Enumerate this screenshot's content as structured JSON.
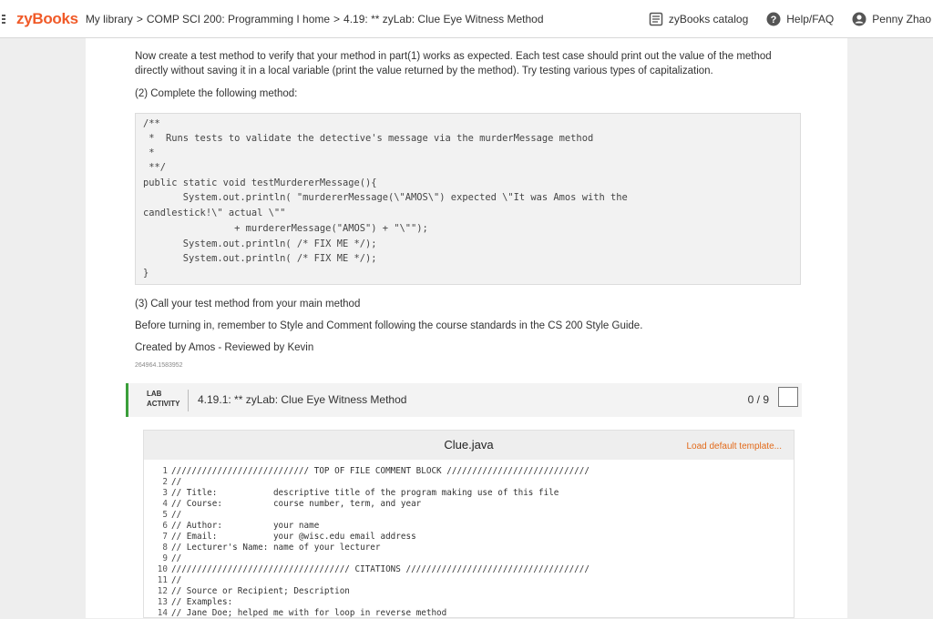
{
  "header": {
    "brand": "zyBooks",
    "breadcrumb": [
      "My library",
      "COMP SCI 200: Programming I home",
      "4.19: ** zyLab: Clue Eye Witness Method"
    ],
    "breadcrumb_sep": ">",
    "catalog": "zyBooks catalog",
    "help": "Help/FAQ",
    "user": "Penny Zhao"
  },
  "content": {
    "intro": "Now create a test method to verify that your method in part(1) works as expected. Each test case should print out the value of the method directly without saving it in a local variable (print the value returned by the method). Try testing various types of capitalization.",
    "step2": "(2) Complete the following method:",
    "code": [
      "/**",
      " *  Runs tests to validate the detective's message via the murderMessage method",
      " *",
      " **/",
      "public static void testMurdererMessage(){",
      "       System.out.println( \"murdererMessage(\\\"AMOS\\\") expected \\\"It was Amos with the",
      "candlestick!\\\" actual \\\"\"",
      "                + murdererMessage(\"AMOS\") + \"\\\"\");",
      "       System.out.println( /* FIX ME */);",
      "       System.out.println( /* FIX ME */);",
      "",
      "}"
    ],
    "step3": "(3) Call your test method from your main method",
    "style_note": "Before turning in, remember to Style and Comment following the course standards in the CS 200 Style Guide.",
    "credits": "Created by Amos - Reviewed by Kevin",
    "id": "264964.1583952"
  },
  "lab": {
    "tag_line1": "LAB",
    "tag_line2": "ACTIVITY",
    "title": "4.19.1: ** zyLab: Clue Eye Witness Method",
    "score": "0 / 9"
  },
  "editor": {
    "file": "Clue.java",
    "load_default": "Load default template...",
    "lines": [
      "/////////////////////////// TOP OF FILE COMMENT BLOCK ////////////////////////////",
      "//",
      "// Title:           descriptive title of the program making use of this file",
      "// Course:          course number, term, and year",
      "//",
      "// Author:          your name",
      "// Email:           your @wisc.edu email address",
      "// Lecturer's Name: name of your lecturer",
      "//",
      "/////////////////////////////////// CITATIONS ////////////////////////////////////",
      "//",
      "// Source or Recipient; Description",
      "// Examples:",
      "// Jane Doe; helped me with for loop in reverse method"
    ]
  }
}
